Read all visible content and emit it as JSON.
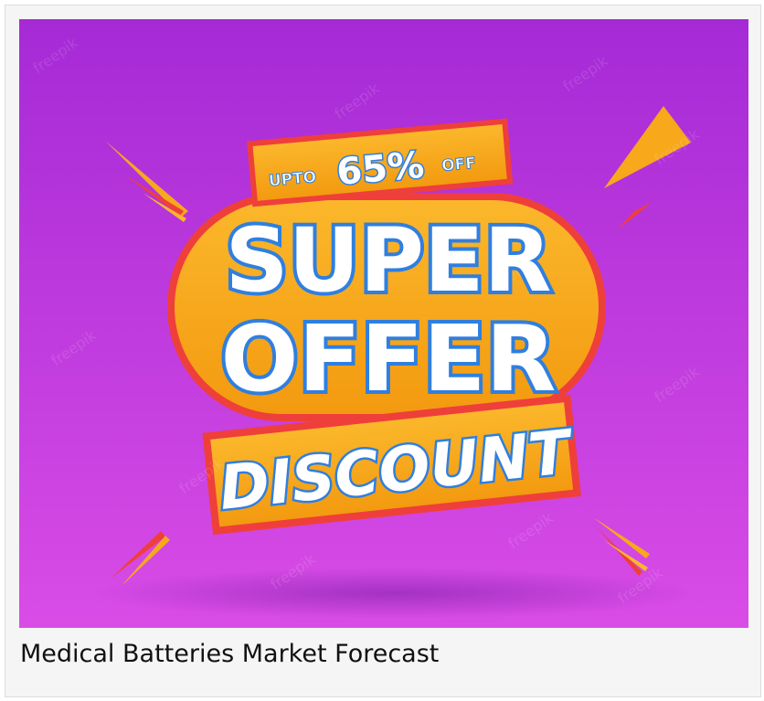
{
  "card": {
    "caption": "Medical Batteries Market Forecast"
  },
  "promo": {
    "upto": "UPTO",
    "percent": "65%",
    "off": "OFF",
    "line1": "SUPER",
    "line2": "OFFER",
    "line3": "DISCOUNT",
    "watermark": "freepik"
  },
  "colors": {
    "background_top": "#a52ad6",
    "background_bottom": "#d94ce6",
    "badge": "#f7a81b",
    "badge_edge": "#ef3f3a",
    "text_fill": "#ffffff",
    "text_stroke": "#2f7fe0"
  }
}
